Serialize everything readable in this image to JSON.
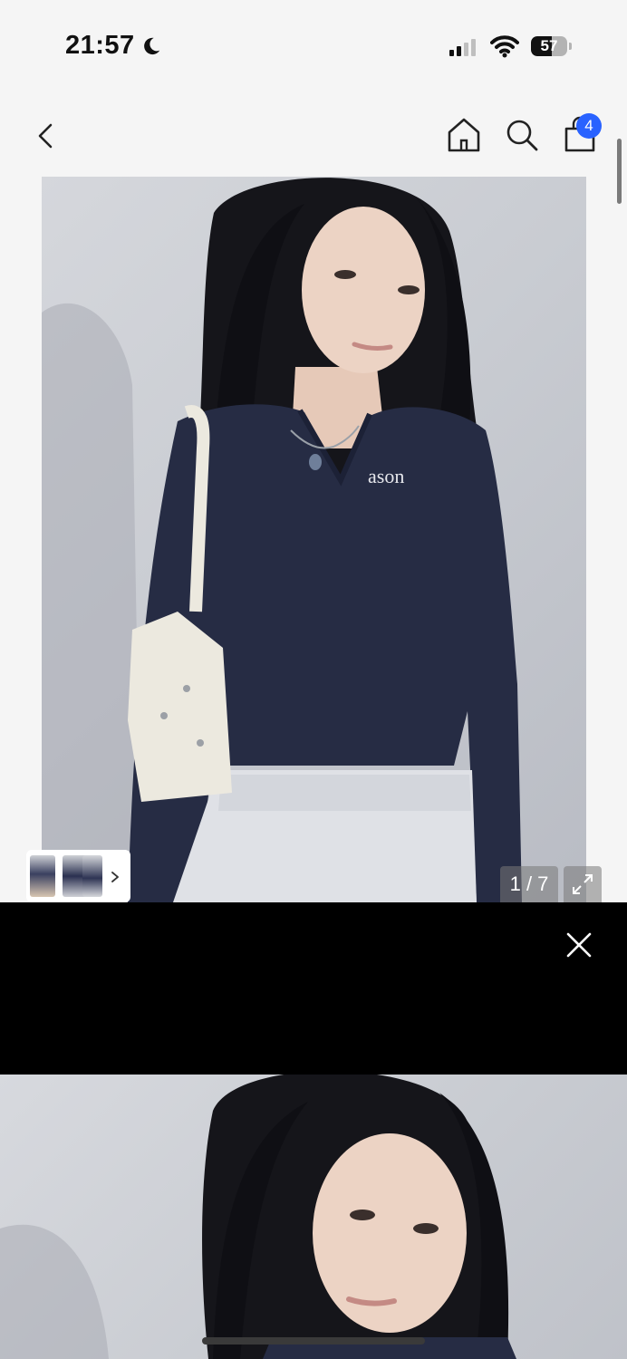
{
  "status_bar": {
    "time": "21:57",
    "battery_percent": "57",
    "battery_level": 0.57,
    "signal_bars_active": 2,
    "signal_bars_total": 4,
    "focus_mode_icon": "moon-icon",
    "wifi_icon": "wifi-icon"
  },
  "nav": {
    "back_icon": "chevron-left-icon",
    "home_icon": "home-icon",
    "search_icon": "search-icon",
    "bag_icon": "shopping-bag-icon",
    "cart_count": "4"
  },
  "product_image": {
    "shirt_logo_text": "ason",
    "counter": "1 / 7",
    "expand_icon": "expand-icon"
  },
  "thumbnails": {
    "count": 3,
    "more_icon": "chevron-right-icon"
  },
  "video_overlay": {
    "close_icon": "close-icon"
  },
  "colors": {
    "accent": "#2962ff",
    "background": "#f5f5f5",
    "shirt_navy": "#262c44"
  }
}
